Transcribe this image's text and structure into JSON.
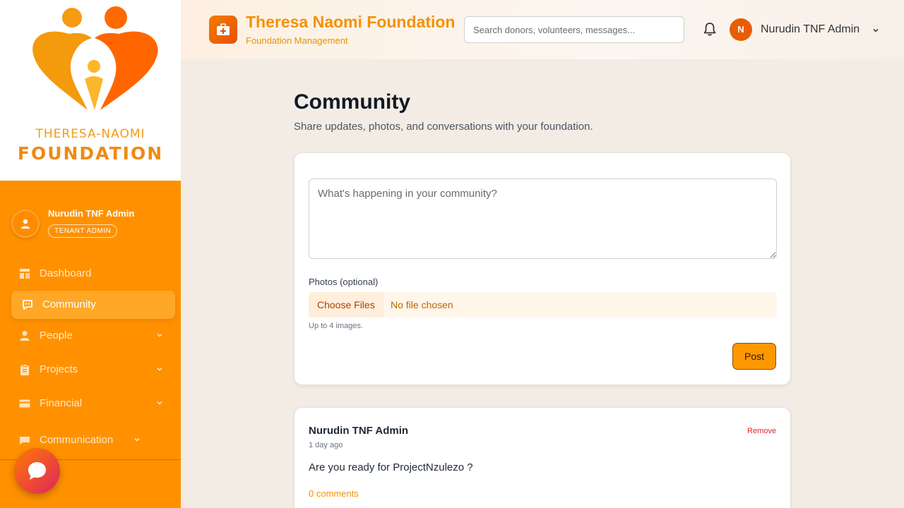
{
  "logo": {
    "line1": "THERESA-NAOMI",
    "line2": "FOUNDATION"
  },
  "sidebar": {
    "user": {
      "name": "Nurudin TNF Admin",
      "role": "TENANT ADMIN"
    },
    "items": [
      {
        "label": "Dashboard",
        "icon": "dashboard-icon"
      },
      {
        "label": "Community",
        "icon": "community-icon",
        "active": true
      },
      {
        "label": "People",
        "icon": "person-icon",
        "expandable": true
      },
      {
        "label": "Projects",
        "icon": "clipboard-icon",
        "expandable": true
      },
      {
        "label": "Financial",
        "icon": "card-icon",
        "expandable": true
      },
      {
        "label": "Communication",
        "icon": "message-icon",
        "expandable": true
      }
    ]
  },
  "header": {
    "title": "Theresa Naomi Foundation",
    "subtitle": "Foundation Management",
    "search_placeholder": "Search donors, volunteers, messages...",
    "user_initial": "N",
    "user_name": "Nurudin TNF Admin"
  },
  "main": {
    "title": "Community",
    "subtitle": "Share updates, photos, and conversations with your foundation.",
    "composer": {
      "placeholder": "What's happening in your community?",
      "photos_label": "Photos (optional)",
      "choose_label": "Choose Files",
      "no_file": "No file chosen",
      "hint": "Up to 4 images.",
      "post_label": "Post"
    },
    "posts": [
      {
        "author": "Nurudin TNF Admin",
        "time": "1 day ago",
        "remove_label": "Remove",
        "body": "Are you ready for ProjectNzulezo ?",
        "comments": "0 comments"
      }
    ]
  },
  "colors": {
    "brand": "#ff9100",
    "accent": "#f39200",
    "danger": "#d62828"
  }
}
